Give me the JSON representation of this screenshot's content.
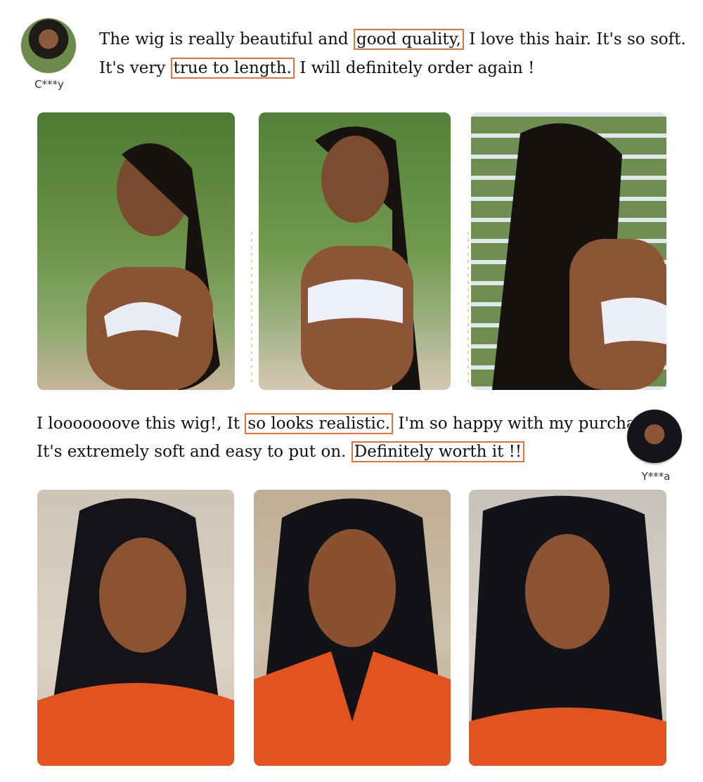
{
  "reviews": [
    {
      "reviewer": "C***y",
      "line1": {
        "pre": "The wig is really beautiful and ",
        "hl": "good quality,",
        "post": " I love this hair. It's so soft."
      },
      "line2": {
        "pre": "It's very ",
        "hl": "true to length.",
        "post": " I will definitely order again !"
      }
    },
    {
      "reviewer": "Y***a",
      "line1": {
        "pre": "I looooooove this wig!, It ",
        "hl": "so looks realistic.",
        "post": " I'm so happy with my purchase."
      },
      "line2": {
        "pre": "It's extremely soft and easy to put on. ",
        "hl": "Definitely worth it !!",
        "post": ""
      }
    }
  ],
  "colors": {
    "highlight_border": "#e8743b",
    "foliage": "#5f7f3a",
    "car_interior": "#d8cfc2",
    "top": "#e2531f"
  }
}
